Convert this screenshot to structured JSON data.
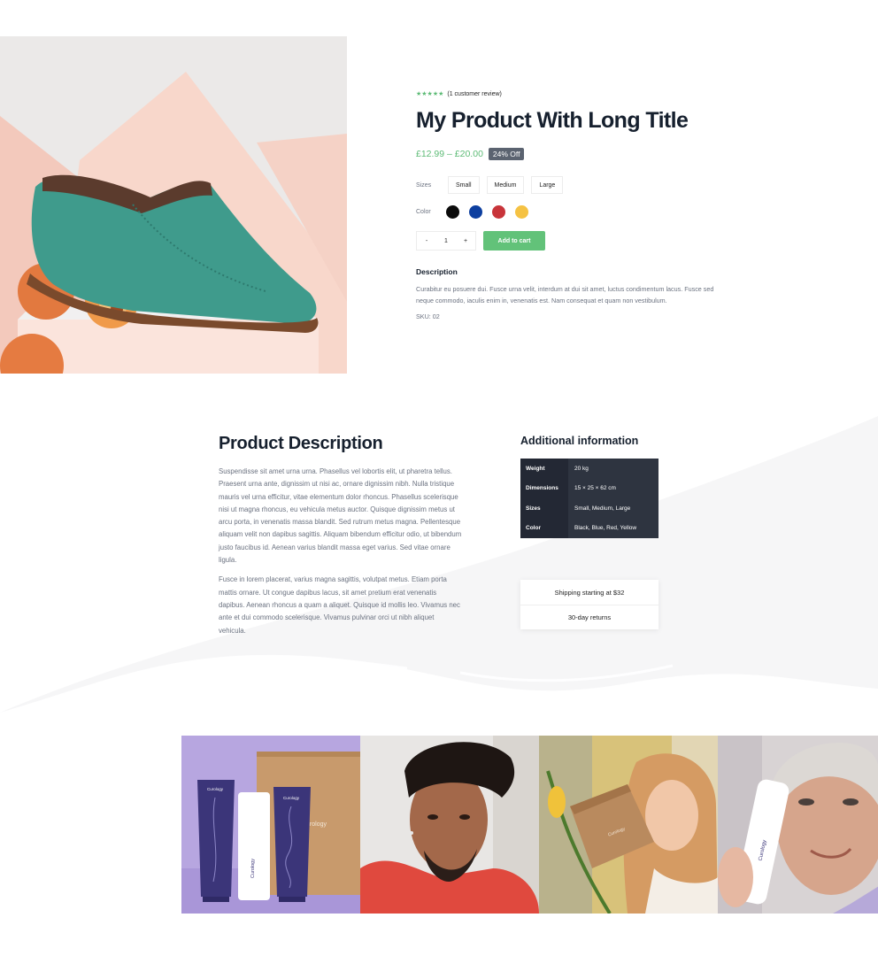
{
  "product": {
    "rating_stars": "★★★★★",
    "review_text": "(1 customer review)",
    "title": "My Product With Long Title",
    "price_range": "£12.99 – £20.00",
    "discount_badge": "24% Off",
    "sizes_label": "Sizes",
    "sizes": [
      "Small",
      "Medium",
      "Large"
    ],
    "color_label": "Color",
    "colors": [
      {
        "name": "black",
        "hex": "#0b0b0b"
      },
      {
        "name": "blue",
        "hex": "#0d3f9f"
      },
      {
        "name": "red",
        "hex": "#c8343a"
      },
      {
        "name": "yellow",
        "hex": "#f5c243"
      }
    ],
    "qty_minus": "-",
    "qty_value": "1",
    "qty_plus": "+",
    "add_to_cart": "Add to cart",
    "description_heading": "Description",
    "description_text": "Curabitur eu posuere dui. Fusce urna velit, interdum at dui sit amet, luctus condimentum lacus. Fusce sed neque commodo, iaculis enim in, venenatis est. Nam consequat et quam non vestibulum.",
    "sku": "SKU: 02",
    "image": "green-suede-shoe-on-peaches"
  },
  "product_description": {
    "title": "Product Description",
    "paragraph_1": "Suspendisse sit amet urna urna. Phasellus vel lobortis elit, ut pharetra tellus. Praesent urna ante, dignissim ut nisi ac, ornare dignissim nibh. Nulla tristique mauris vel urna efficitur, vitae elementum dolor rhoncus. Phasellus scelerisque nisi ut magna rhoncus, eu vehicula metus auctor. Quisque dignissim metus ut arcu porta, in venenatis massa blandit. Sed rutrum metus magna. Pellentesque aliquam velit non dapibus sagittis. Aliquam bibendum efficitur odio, ut bibendum justo faucibus id. Aenean varius blandit massa eget varius. Sed vitae ornare ligula.",
    "paragraph_2": "Fusce in lorem placerat, varius magna sagittis, volutpat metus. Etiam porta mattis ornare. Ut congue dapibus lacus, sit amet pretium erat venenatis dapibus. Aenean rhoncus a quam a aliquet. Quisque id mollis leo. Vivamus nec ante et dui commodo scelerisque. Vivamus pulvinar orci ut nibh aliquet vehicula."
  },
  "additional_info": {
    "title": "Additional information",
    "rows": [
      {
        "key": "Weight",
        "value": "20 kg"
      },
      {
        "key": "Dimensions",
        "value": "15 × 25 × 62 cm"
      },
      {
        "key": "Sizes",
        "value": "Small, Medium, Large"
      },
      {
        "key": "Color",
        "value": "Black, Blue, Red, Yellow"
      }
    ]
  },
  "shipping": {
    "line_1": "Shipping starting at $32",
    "line_2": "30-day returns"
  },
  "gallery": {
    "brand_text": "Curology",
    "tiles": [
      "curology-products",
      "man-portrait",
      "woman-with-box",
      "elderly-woman-with-bottle"
    ]
  },
  "colors": {
    "accent_green": "#5dbb76",
    "button_green": "#62c279",
    "dark_table": "#2e3440",
    "heading": "#16202e"
  }
}
